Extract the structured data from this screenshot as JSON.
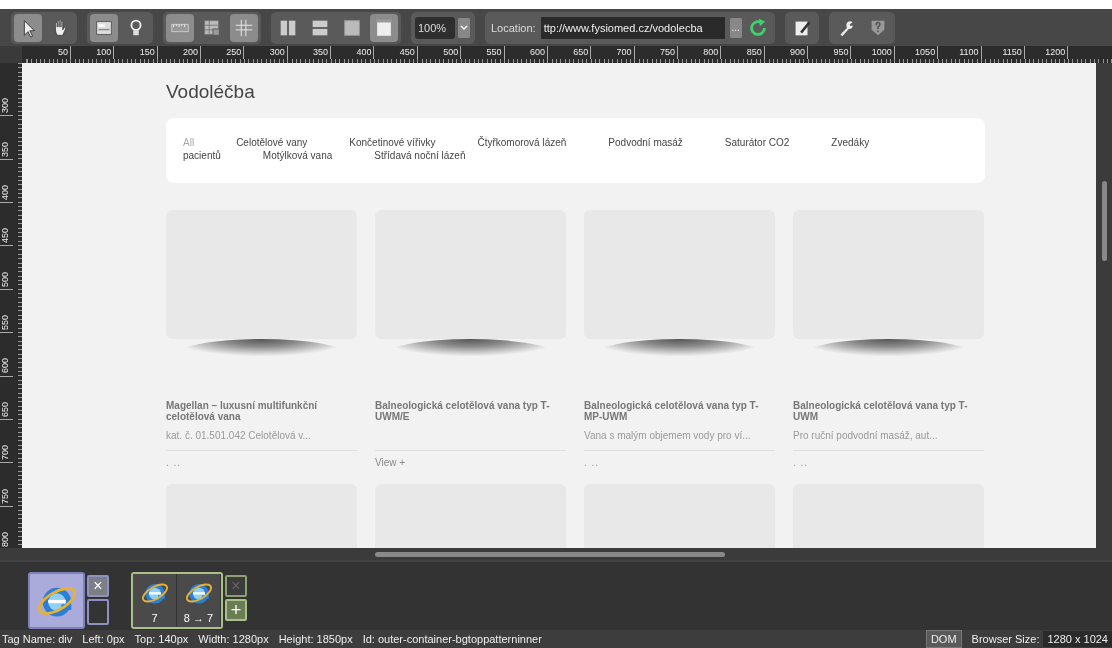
{
  "toolbar": {
    "groups": [
      {
        "buttons": [
          {
            "kind": "pointer",
            "selected": true
          },
          {
            "kind": "hand",
            "selected": false
          }
        ]
      },
      {
        "buttons": [
          {
            "kind": "layout",
            "selected": true
          },
          {
            "kind": "bulb",
            "selected": false
          }
        ]
      },
      {
        "buttons": [
          {
            "kind": "ruler",
            "selected": true
          },
          {
            "kind": "grid",
            "selected": false
          },
          {
            "kind": "guides",
            "selected": true
          }
        ]
      },
      {
        "buttons": [
          {
            "kind": "split-v",
            "selected": false
          },
          {
            "kind": "split-h",
            "selected": false
          },
          {
            "kind": "single",
            "selected": false
          },
          {
            "kind": "window",
            "selected": true
          }
        ]
      }
    ],
    "zoom": {
      "value": "100%"
    },
    "location": {
      "label": "Location:",
      "value": "ttp://www.fysiomed.cz/vodolecba",
      "more": "..."
    },
    "tools": [
      {
        "buttons": [
          {
            "kind": "edit",
            "selected": false
          }
        ]
      },
      {
        "buttons": [
          {
            "kind": "wrench",
            "selected": false
          },
          {
            "kind": "help",
            "selected": false
          }
        ]
      }
    ]
  },
  "ruler": {
    "top_labels": [
      "50",
      "100",
      "150",
      "200",
      "250",
      "300",
      "350",
      "400",
      "450",
      "500",
      "550",
      "600",
      "650",
      "700",
      "750",
      "800",
      "850",
      "900",
      "950",
      "1000",
      "1050",
      "1100",
      "1150",
      "1200"
    ],
    "left_labels": [
      "300",
      "350",
      "400",
      "450",
      "500",
      "550",
      "600",
      "650",
      "700",
      "750",
      "800"
    ]
  },
  "page": {
    "title": "Vodoléčba",
    "filter_rows": [
      [
        {
          "label": "All",
          "selected": true
        },
        {
          "label": "Celotělové vany",
          "selected": false
        },
        {
          "label": "Končetinové vířivky",
          "selected": false
        },
        {
          "label": "Čtyřkomorová lázeň",
          "selected": false
        },
        {
          "label": "Podvodní masáž",
          "selected": false
        },
        {
          "label": "Saturátor CO2",
          "selected": false
        },
        {
          "label": "Zvedáky",
          "selected": false
        }
      ],
      [
        {
          "label": "pacientů",
          "selected": false
        },
        {
          "label": "Motýlková vana",
          "selected": false
        },
        {
          "label": "Střídavá noční lázeň",
          "selected": false
        }
      ]
    ],
    "products": [
      {
        "title": "Magellan – luxusní multifunkční celotělová vana",
        "description": "kat. č. 01.501.042 Celotělová v...",
        "link": ". ..",
        "faded": true
      },
      {
        "title": "Balneologická celotělová vana typ T-UWM/E",
        "link": "View +",
        "faded": false
      },
      {
        "title": "Balneologická celotělová vana typ T-MP-UWM",
        "description": "Vana s malým objemem vody pro ví...",
        "link": ". ..",
        "faded": true
      },
      {
        "title": "Balneologická celotělová vana typ T-UWM",
        "description": "Pro ruční podvodní masáž, aut...",
        "link": ". ..",
        "faded": true
      }
    ],
    "next_row": [
      {
        "kind": "loading"
      },
      {
        "kind": "loading"
      },
      {
        "kind": "loading"
      },
      {
        "kind": "loading"
      }
    ]
  },
  "sessions": [
    {
      "kind": "single",
      "selected": true,
      "close": "×",
      "close_disabled": false
    },
    {
      "kind": "multi",
      "selected": false,
      "tabs": [
        "7",
        "8 → 7"
      ],
      "close": "×",
      "close_disabled": true,
      "add": "+"
    }
  ],
  "status": {
    "items": [
      "Tag Name: div",
      "Left: 0px",
      "Top: 140px",
      "Width: 1280px",
      "Height: 1850px",
      "Id: outer-container-bgtoppatterninner"
    ],
    "dom": "DOM",
    "size_label": "Browser Size:",
    "size": "1280 x 1024"
  }
}
